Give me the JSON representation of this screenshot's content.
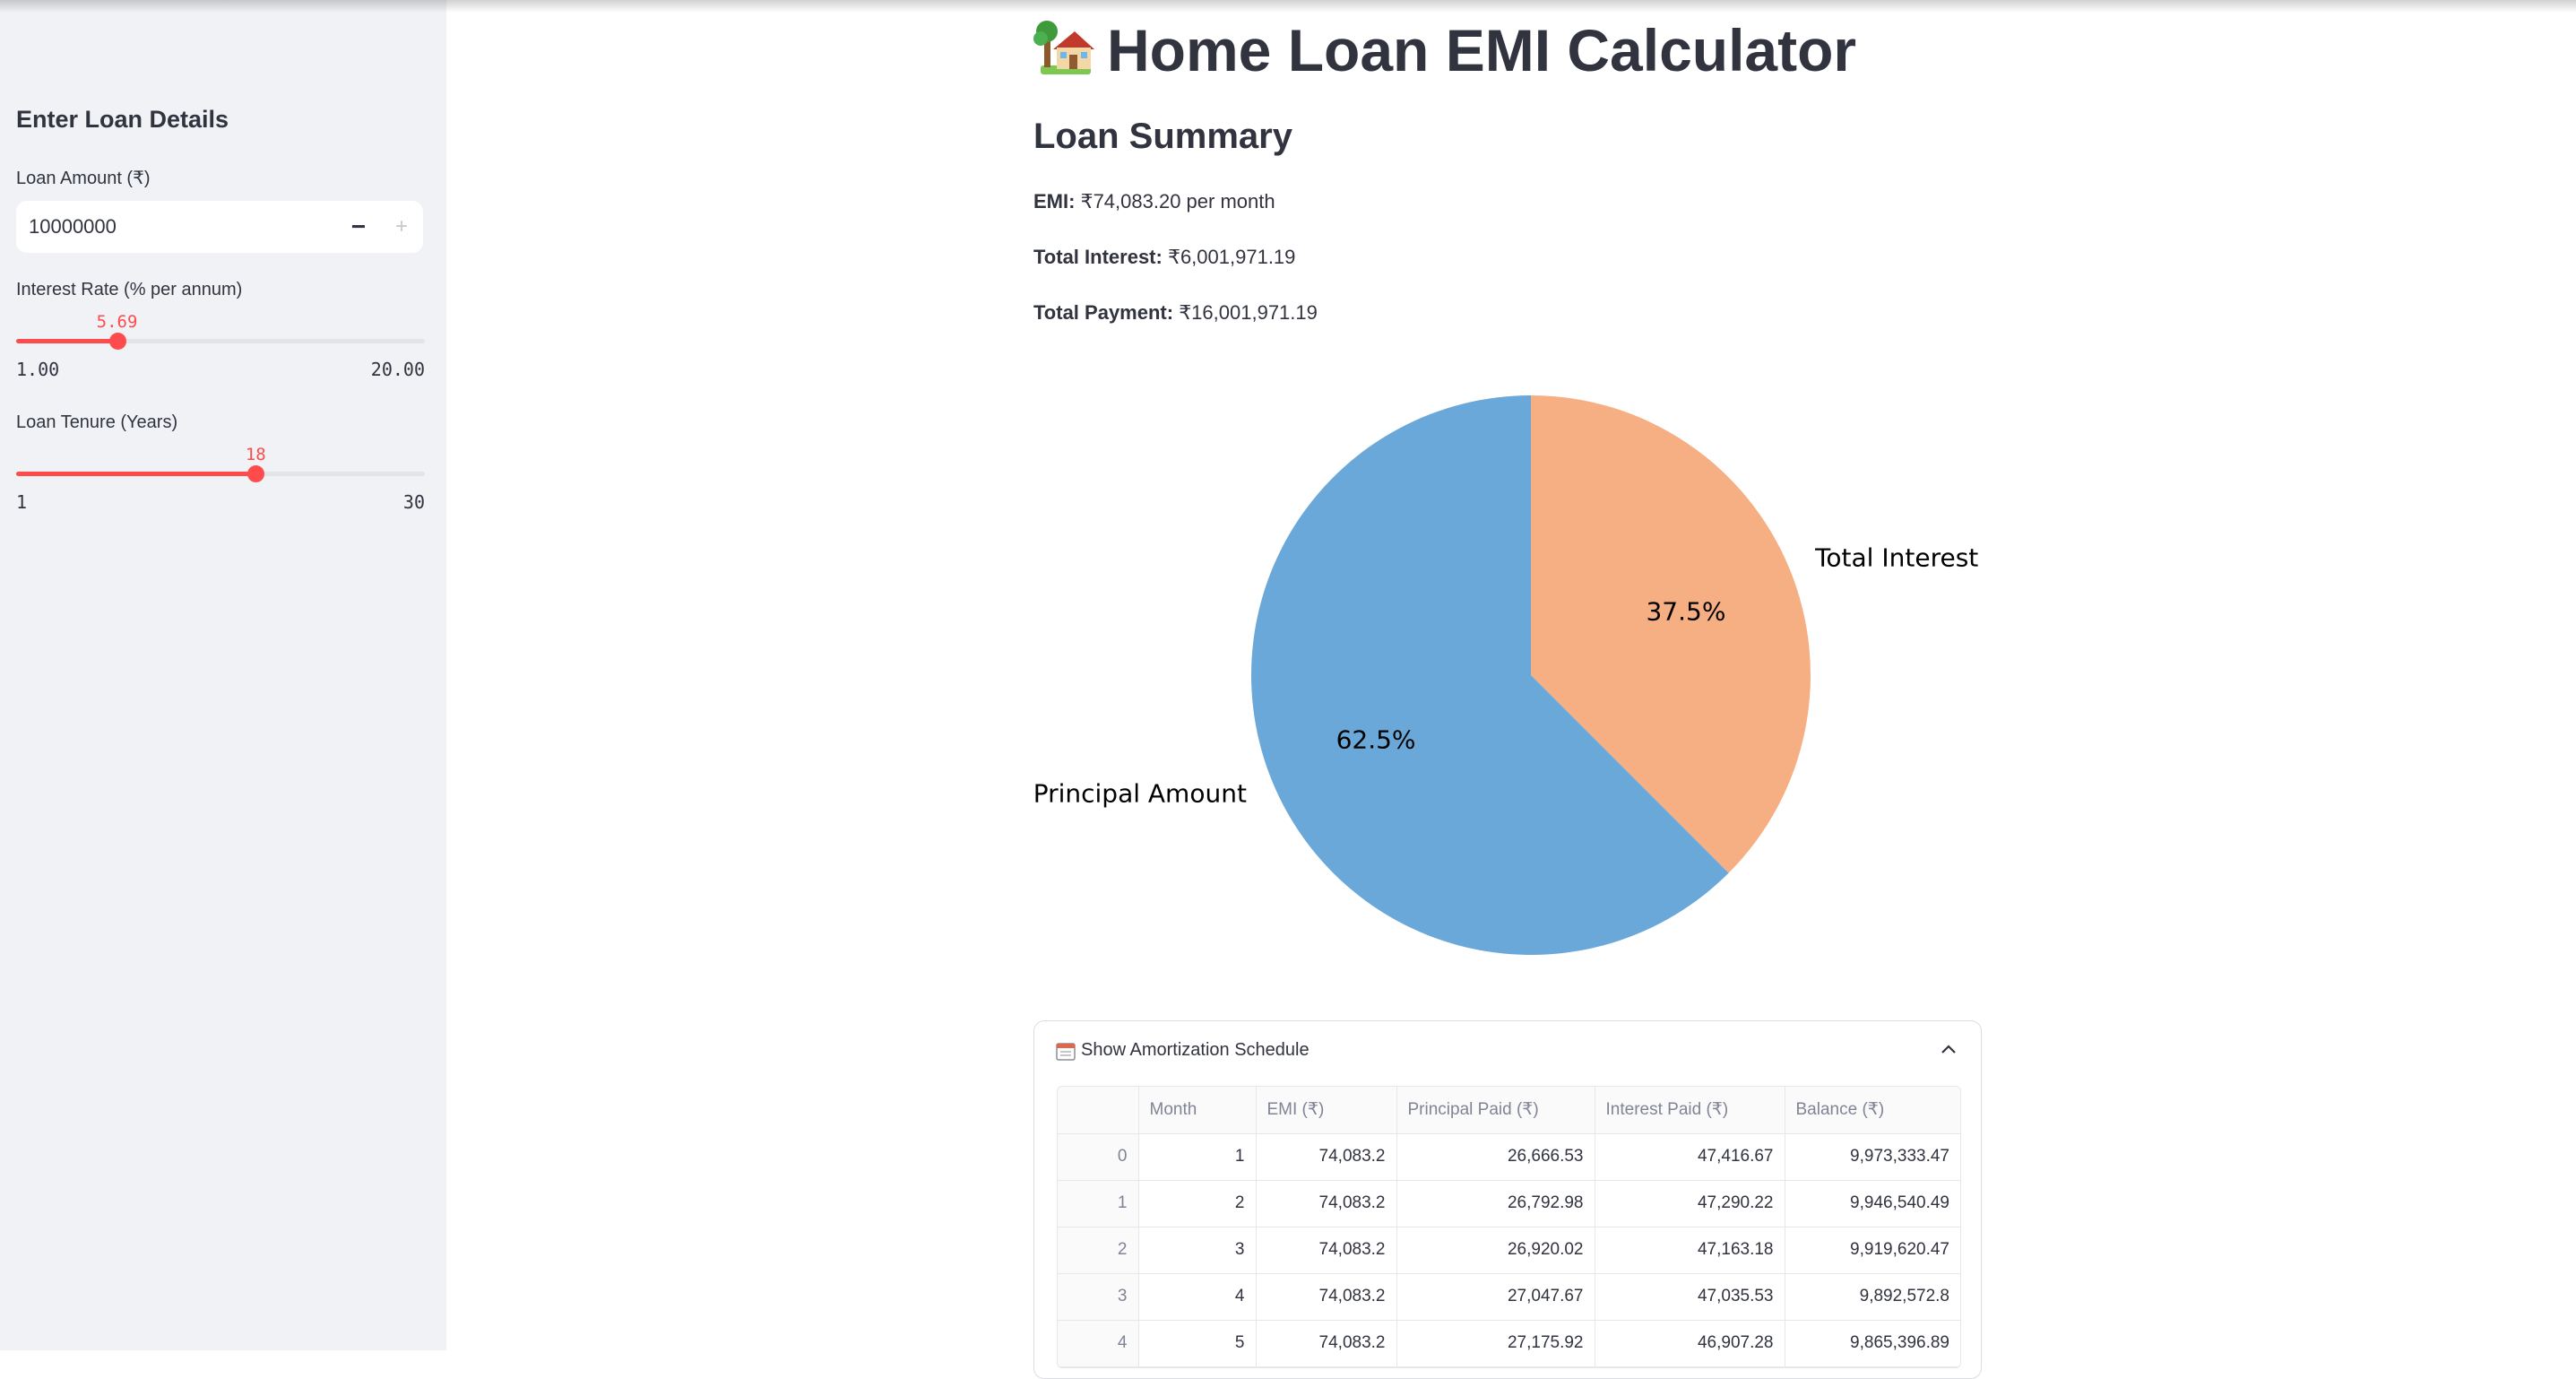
{
  "sidebar": {
    "title": "Enter Loan Details",
    "loan_amount": {
      "label": "Loan Amount (₹)",
      "value": "10000000",
      "minus": "−",
      "plus": "+"
    },
    "interest_rate": {
      "label": "Interest Rate (% per annum)",
      "value": "5.69",
      "min": "1.00",
      "max": "20.00",
      "fraction": 0.2468
    },
    "tenure": {
      "label": "Loan Tenure (Years)",
      "value": "18",
      "min": "1",
      "max": "30",
      "fraction": 0.5862
    }
  },
  "main": {
    "title": "Home Loan EMI Calculator",
    "title_icon": "house-with-garden-icon",
    "summary": {
      "heading": "Loan Summary",
      "emi_label": "EMI:",
      "emi_value": "₹74,083.20 per month",
      "interest_label": "Total Interest:",
      "interest_value": "₹6,001,971.19",
      "payment_label": "Total Payment:",
      "payment_value": "₹16,001,971.19"
    }
  },
  "chart_data": {
    "type": "pie",
    "slices": [
      {
        "label": "Principal Amount",
        "value": 62.5,
        "pct_label": "62.5%",
        "color": "#6aa8da"
      },
      {
        "label": "Total Interest",
        "value": 37.5,
        "pct_label": "37.5%",
        "color": "#f6af83"
      }
    ]
  },
  "schedule": {
    "label": "Show Amortization Schedule",
    "icon": "calendar-icon",
    "columns": [
      "",
      "Month",
      "EMI (₹)",
      "Principal Paid (₹)",
      "Interest Paid (₹)",
      "Balance (₹)"
    ],
    "rows": [
      [
        "0",
        "1",
        "74,083.2",
        "26,666.53",
        "47,416.67",
        "9,973,333.47"
      ],
      [
        "1",
        "2",
        "74,083.2",
        "26,792.98",
        "47,290.22",
        "9,946,540.49"
      ],
      [
        "2",
        "3",
        "74,083.2",
        "26,920.02",
        "47,163.18",
        "9,919,620.47"
      ],
      [
        "3",
        "4",
        "74,083.2",
        "27,047.67",
        "47,035.53",
        "9,892,572.8"
      ],
      [
        "4",
        "5",
        "74,083.2",
        "27,175.92",
        "46,907.28",
        "9,865,396.89"
      ]
    ]
  }
}
